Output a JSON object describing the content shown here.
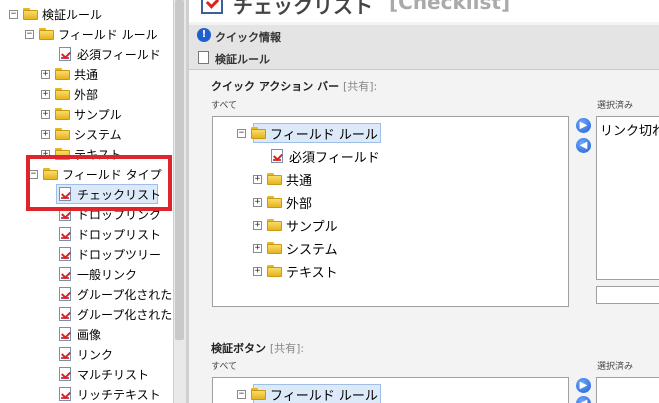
{
  "tree": {
    "items": [
      {
        "label": "検証ルール",
        "type": "folder",
        "expander": "−"
      },
      {
        "label": "フィールド ルール",
        "type": "folder",
        "expander": "−"
      },
      {
        "label": "必須フィールド",
        "type": "item",
        "expander": ""
      },
      {
        "label": "共通",
        "type": "folder",
        "expander": "+"
      },
      {
        "label": "外部",
        "type": "folder",
        "expander": "+"
      },
      {
        "label": "サンプル",
        "type": "folder",
        "expander": "+"
      },
      {
        "label": "システム",
        "type": "folder",
        "expander": "+"
      },
      {
        "label": "テキスト",
        "type": "folder",
        "expander": "+"
      },
      {
        "label": "フィールド タイプ",
        "type": "folder",
        "expander": "−"
      },
      {
        "label": "チェックリスト",
        "type": "item",
        "expander": ""
      },
      {
        "label": "ドロップリンク",
        "type": "item",
        "expander": ""
      },
      {
        "label": "ドロップリスト",
        "type": "item",
        "expander": ""
      },
      {
        "label": "ドロップツリー",
        "type": "item",
        "expander": ""
      },
      {
        "label": "一般リンク",
        "type": "item",
        "expander": ""
      },
      {
        "label": "グループ化された ド",
        "type": "item",
        "expander": ""
      },
      {
        "label": "グループ化された ド",
        "type": "item",
        "expander": ""
      },
      {
        "label": "画像",
        "type": "item",
        "expander": ""
      },
      {
        "label": "リンク",
        "type": "item",
        "expander": ""
      },
      {
        "label": "マルチリスト",
        "type": "item",
        "expander": ""
      },
      {
        "label": "リッチテキスト",
        "type": "item",
        "expander": ""
      }
    ]
  },
  "header": {
    "title": "チェックリスト",
    "subtitle": "[Checklist]"
  },
  "sections": {
    "quick_info": "クイック情報",
    "validation_rules": "検証ルール"
  },
  "quick_action_bar": {
    "title": "クイック アクション バー",
    "shared": "[共有]:",
    "all_label": "すべて",
    "selected_label": "選択済み",
    "tree": [
      {
        "label": "フィールド ルール",
        "type": "folder",
        "expander": "−"
      },
      {
        "label": "必須フィールド",
        "type": "item",
        "expander": ""
      },
      {
        "label": "共通",
        "type": "folder",
        "expander": "+"
      },
      {
        "label": "外部",
        "type": "folder",
        "expander": "+"
      },
      {
        "label": "サンプル",
        "type": "folder",
        "expander": "+"
      },
      {
        "label": "システム",
        "type": "folder",
        "expander": "+"
      },
      {
        "label": "テキスト",
        "type": "folder",
        "expander": "+"
      }
    ],
    "selected_items": [
      "リンク切れ"
    ],
    "add_icon": "arrow-right-icon",
    "remove_icon": "arrow-left-icon"
  },
  "validation_button": {
    "title": "検証ボタン",
    "shared": "[共有]:",
    "all_label": "すべて",
    "selected_label": "選択済み",
    "tree": [
      {
        "label": "フィールド ルール",
        "type": "folder",
        "expander": "−"
      }
    ]
  },
  "colors": {
    "highlight_box": "#e0242c",
    "selected_bg": "#dce9f8",
    "section_bg": "#e4e4e4",
    "folder": "#f0c83a",
    "arrow": "#2a6fdb"
  }
}
